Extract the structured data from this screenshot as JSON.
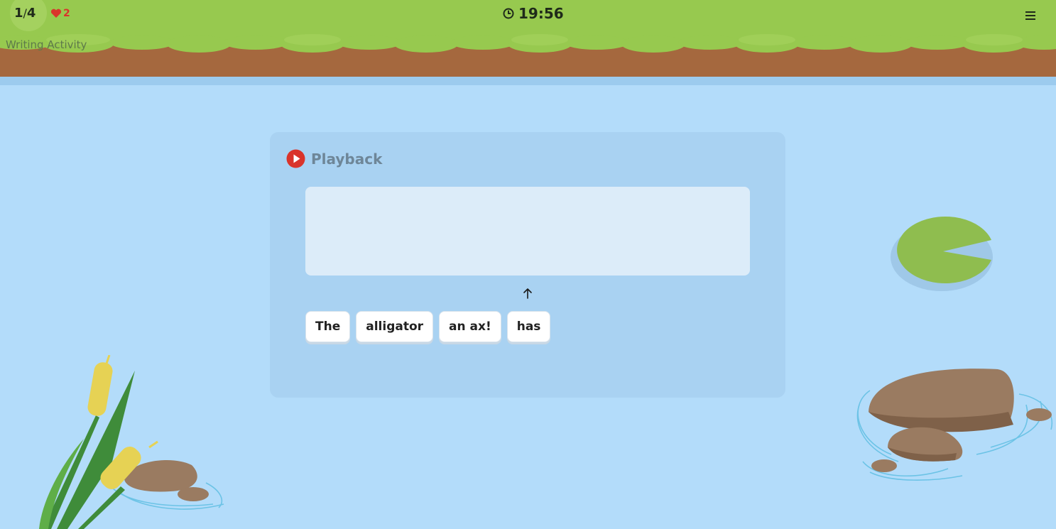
{
  "header": {
    "progress_current": "1",
    "progress_total": "4",
    "lives": "2",
    "timer": "19:56",
    "activity_title": "Writing Activity"
  },
  "panel": {
    "playback_label": "Playback",
    "answer_text": "",
    "word_bank": [
      "The",
      "alligator",
      "an ax!",
      "has"
    ]
  },
  "icons": {
    "heart": "heart-icon",
    "clock": "clock-icon",
    "menu": "hamburger-menu-icon",
    "play": "play-icon",
    "arrow": "arrow-up-icon"
  },
  "colors": {
    "grass": "#97c94f",
    "dirt": "#a5683e",
    "water": "#b3dcfa",
    "panel": "#a9d2f2",
    "playback_red": "#d9342b"
  }
}
